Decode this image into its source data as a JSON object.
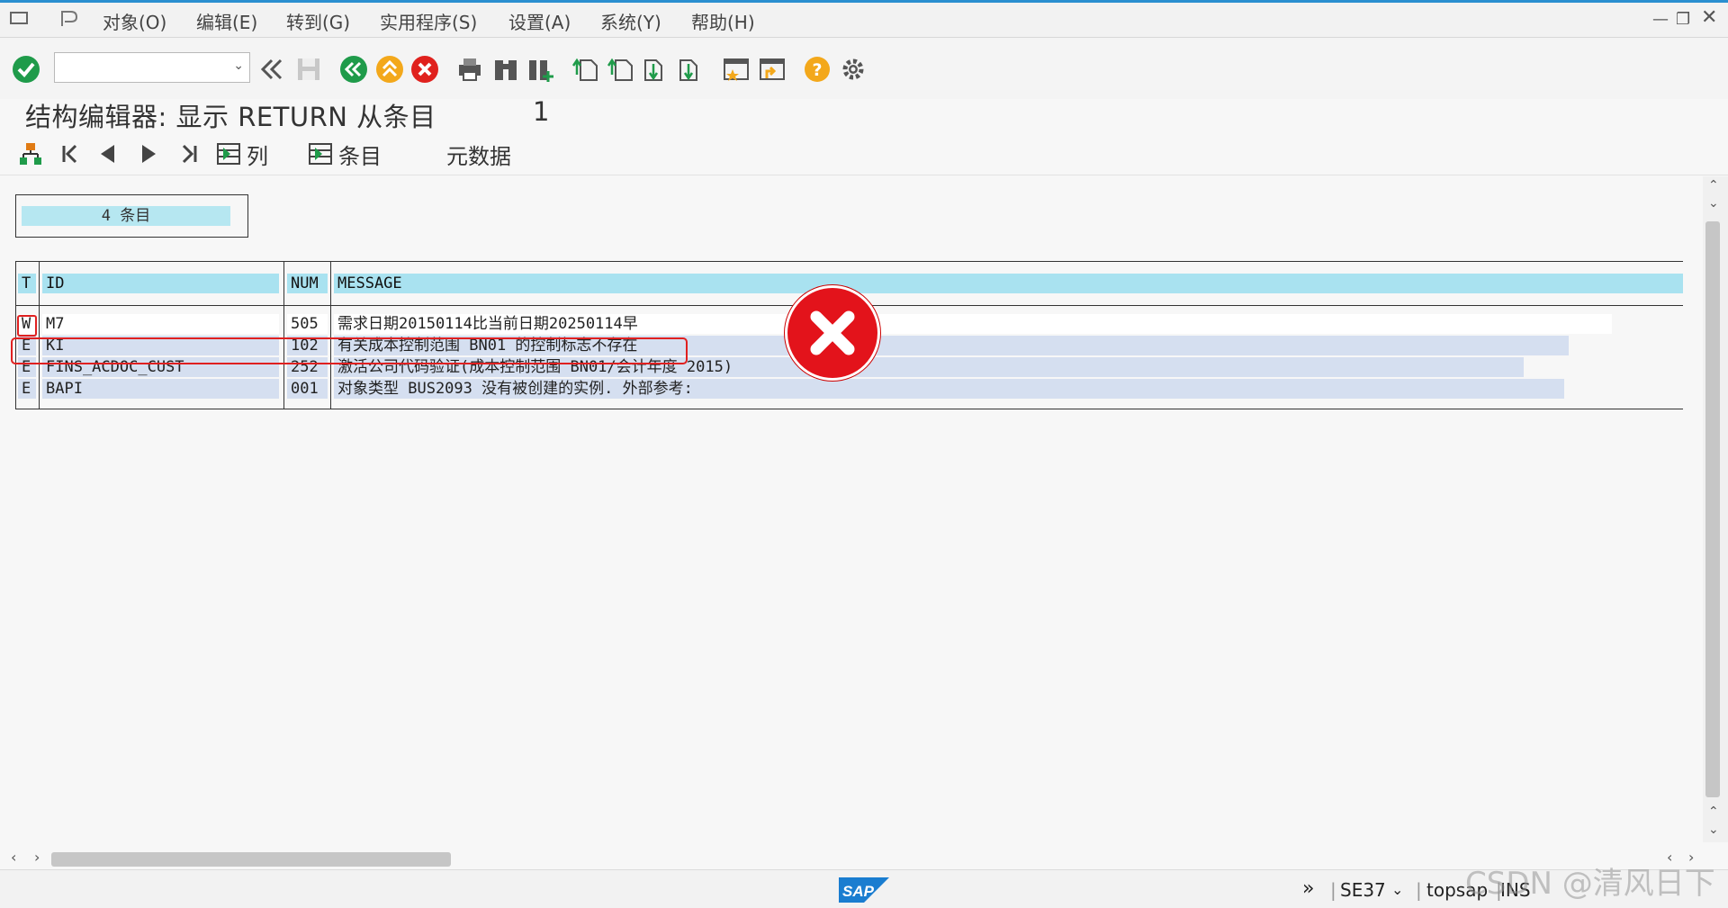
{
  "menu": {
    "items": [
      "对象(O)",
      "编辑(E)",
      "转到(G)",
      "实用程序(S)",
      "设置(A)",
      "系统(Y)",
      "帮助(H)"
    ]
  },
  "toolbar": {
    "command_field_value": "",
    "icons": [
      "check-icon",
      "back-double-icon",
      "save-icon",
      "back-icon",
      "exit-icon",
      "cancel-icon",
      "print-icon",
      "find-icon",
      "find-next-icon",
      "first-page-icon",
      "previous-page-icon",
      "next-page-icon",
      "last-page-icon",
      "new-session-icon",
      "shortcut-icon",
      "help-icon",
      "settings-icon"
    ]
  },
  "title": {
    "text": "结构编辑器: 显示 RETURN 从条目",
    "number": "1"
  },
  "app_toolbar": {
    "columns_label": "列",
    "entries_label": "条目",
    "metadata_label": "元数据"
  },
  "entries_count": "4 条目",
  "table": {
    "headers": [
      "T",
      "ID",
      "NUM",
      "MESSAGE"
    ],
    "rows": [
      {
        "t": "W",
        "id": "M7",
        "num": "505",
        "message": "需求日期20150114比当前日期20250114早"
      },
      {
        "t": "E",
        "id": "KI",
        "num": "102",
        "message": "有关成本控制范围 BN01 的控制标志不存在"
      },
      {
        "t": "E",
        "id": "FINS_ACDOC_CUST",
        "num": "252",
        "message": "激活公司代码验证(成本控制范围 BN01/会计年度 2015)"
      },
      {
        "t": "E",
        "id": "BAPI",
        "num": "001",
        "message": "对象类型 BUS2093 没有被创建的实例. 外部参考:"
      }
    ]
  },
  "statusbar": {
    "logo": "SAP",
    "transaction": "SE37",
    "server": "topsap",
    "mode": "INS"
  },
  "watermark": "CSDN @清风日下",
  "colors": {
    "header_bg": "#a9e2f0",
    "row_blue": "#d5dff0",
    "highlight_red": "#e02020",
    "accent_top": "#2a8fd0"
  }
}
